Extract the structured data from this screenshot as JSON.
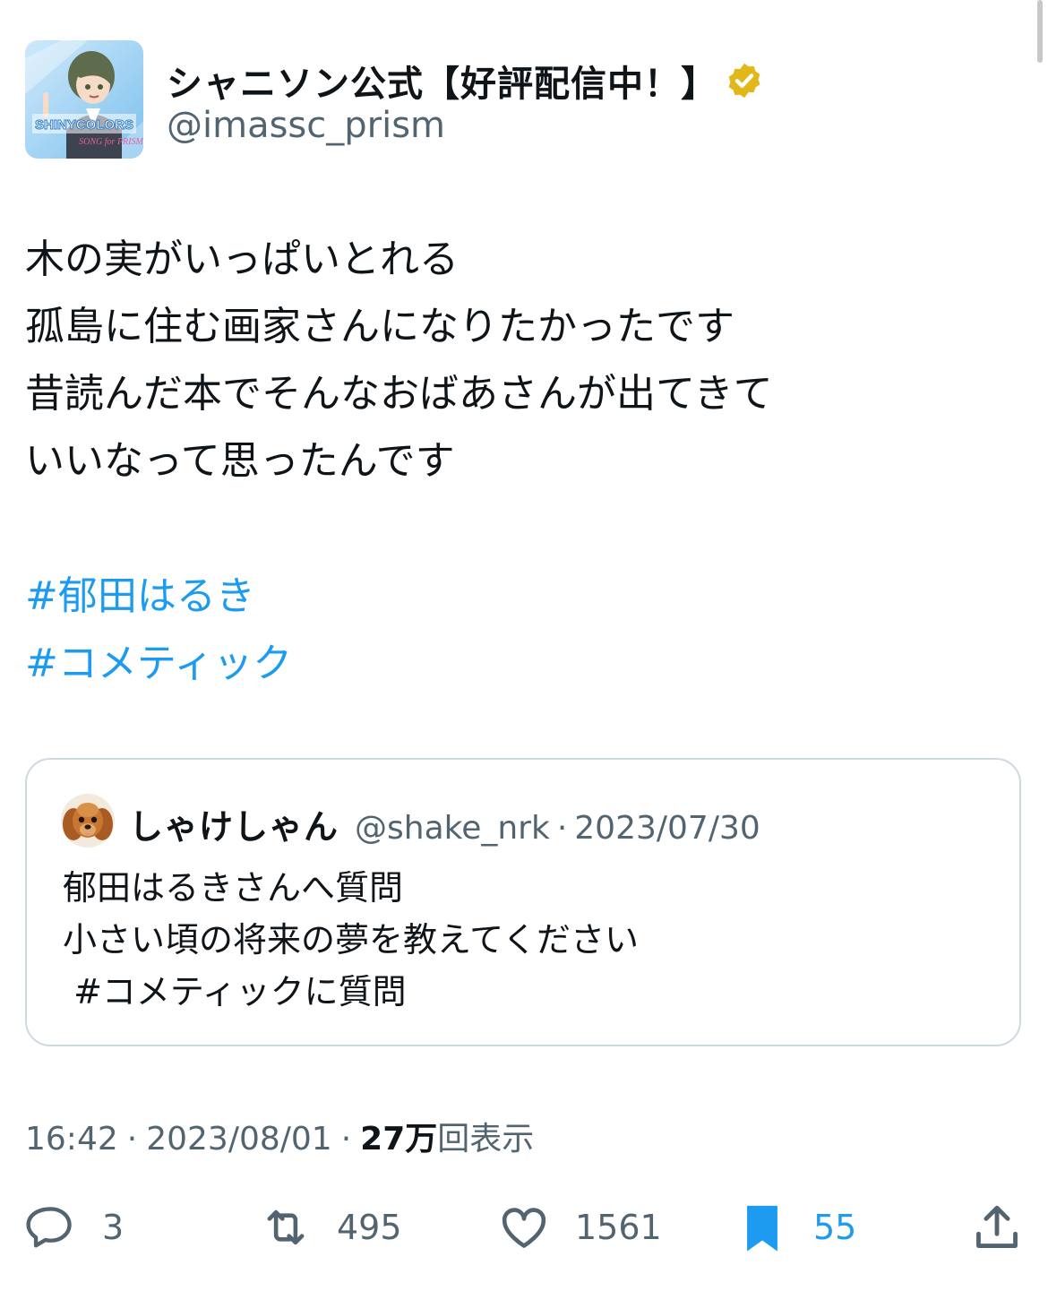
{
  "author": {
    "display_name": "シャニソン公式【好評配信中！】",
    "handle": "@imassc_prism",
    "avatar_logo_text": "SHINYCOLORS",
    "verified_color": "#e2b719"
  },
  "tweet": {
    "lines": [
      "木の実がいっぱいとれる",
      "孤島に住む画家さんになりたかったです",
      "昔読んだ本でそんなおばあさんが出てきて",
      "いいなって思ったんです"
    ],
    "hashtags": [
      "#郁田はるき",
      "#コメティック"
    ]
  },
  "quote": {
    "display_name": "しゃけしゃん",
    "handle": "@shake_nrk",
    "separator": "·",
    "date": "2023/07/30",
    "lines": [
      "郁田はるきさんへ質問",
      "小さい頃の将来の夢を教えてください",
      " #コメティックに質問"
    ]
  },
  "meta": {
    "time": "16:42",
    "sep1": "·",
    "date": "2023/08/01",
    "sep2": "·",
    "views_count": "27万",
    "views_label": "回表示"
  },
  "actions": {
    "reply_count": "3",
    "retweet_count": "495",
    "like_count": "1561",
    "bookmark_count": "55"
  },
  "colors": {
    "link": "#1d9bf0",
    "muted": "#536471",
    "border": "#cfd9de"
  }
}
